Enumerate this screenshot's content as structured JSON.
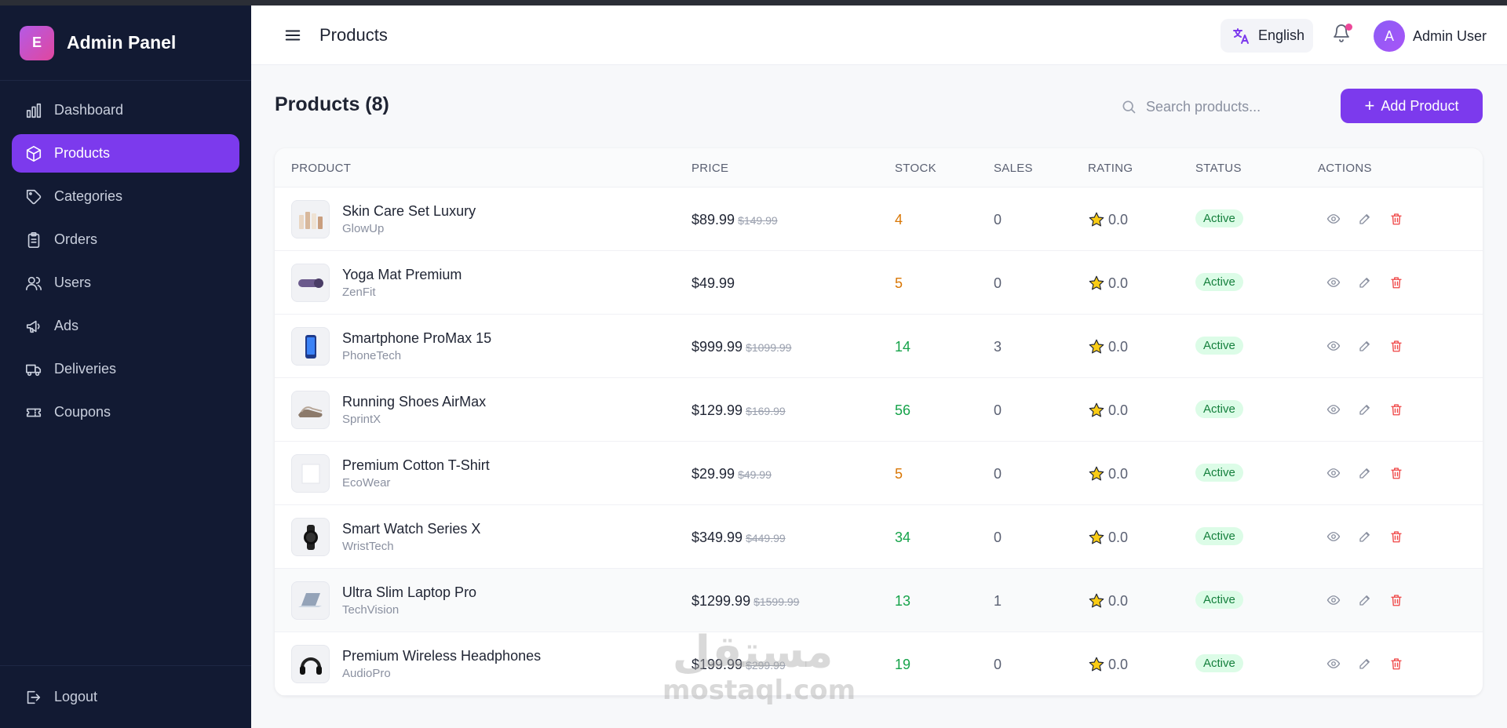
{
  "brand": {
    "logo_letter": "E",
    "title": "Admin Panel"
  },
  "sidebar": {
    "items": [
      {
        "label": "Dashboard",
        "icon": "bar-chart-icon"
      },
      {
        "label": "Products",
        "icon": "box-icon",
        "active": true
      },
      {
        "label": "Categories",
        "icon": "tag-icon"
      },
      {
        "label": "Orders",
        "icon": "clipboard-icon"
      },
      {
        "label": "Users",
        "icon": "users-icon"
      },
      {
        "label": "Ads",
        "icon": "megaphone-icon"
      },
      {
        "label": "Deliveries",
        "icon": "truck-icon"
      },
      {
        "label": "Coupons",
        "icon": "ticket-icon"
      }
    ],
    "logout_label": "Logout"
  },
  "header": {
    "title": "Products",
    "language": "English",
    "user": {
      "initial": "A",
      "name": "Admin User"
    }
  },
  "main": {
    "heading": "Products (8)",
    "search_placeholder": "Search products...",
    "add_button": "Add Product",
    "columns": [
      "PRODUCT",
      "PRICE",
      "STOCK",
      "SALES",
      "RATING",
      "STATUS",
      "ACTIONS"
    ],
    "products": [
      {
        "name": "Skin Care Set Luxury",
        "brand": "GlowUp",
        "price": "$89.99",
        "old_price": "$149.99",
        "stock": "4",
        "stock_color": "#d97706",
        "sales": "0",
        "rating": "0.0",
        "status": "Active"
      },
      {
        "name": "Yoga Mat Premium",
        "brand": "ZenFit",
        "price": "$49.99",
        "old_price": "",
        "stock": "5",
        "stock_color": "#d97706",
        "sales": "0",
        "rating": "0.0",
        "status": "Active"
      },
      {
        "name": "Smartphone ProMax 15",
        "brand": "PhoneTech",
        "price": "$999.99",
        "old_price": "$1099.99",
        "stock": "14",
        "stock_color": "#16a34a",
        "sales": "3",
        "rating": "0.0",
        "status": "Active"
      },
      {
        "name": "Running Shoes AirMax",
        "brand": "SprintX",
        "price": "$129.99",
        "old_price": "$169.99",
        "stock": "56",
        "stock_color": "#16a34a",
        "sales": "0",
        "rating": "0.0",
        "status": "Active"
      },
      {
        "name": "Premium Cotton T-Shirt",
        "brand": "EcoWear",
        "price": "$29.99",
        "old_price": "$49.99",
        "stock": "5",
        "stock_color": "#d97706",
        "sales": "0",
        "rating": "0.0",
        "status": "Active"
      },
      {
        "name": "Smart Watch Series X",
        "brand": "WristTech",
        "price": "$349.99",
        "old_price": "$449.99",
        "stock": "34",
        "stock_color": "#16a34a",
        "sales": "0",
        "rating": "0.0",
        "status": "Active"
      },
      {
        "name": "Ultra Slim Laptop Pro",
        "brand": "TechVision",
        "price": "$1299.99",
        "old_price": "$1599.99",
        "stock": "13",
        "stock_color": "#16a34a",
        "sales": "1",
        "rating": "0.0",
        "status": "Active",
        "highlighted": true
      },
      {
        "name": "Premium Wireless Headphones",
        "brand": "AudioPro",
        "price": "$199.99",
        "old_price": "$299.99",
        "stock": "19",
        "stock_color": "#16a34a",
        "sales": "0",
        "rating": "0.0",
        "status": "Active"
      }
    ]
  },
  "watermark": {
    "arabic": "مستقل",
    "latin": "mostaql.com"
  },
  "colors": {
    "accent": "#7c3aed",
    "sidebar_bg": "#121a33",
    "active_badge_bg": "#dcfce7",
    "active_badge_text": "#15803d",
    "delete": "#ef4444",
    "star": "#facc15"
  }
}
